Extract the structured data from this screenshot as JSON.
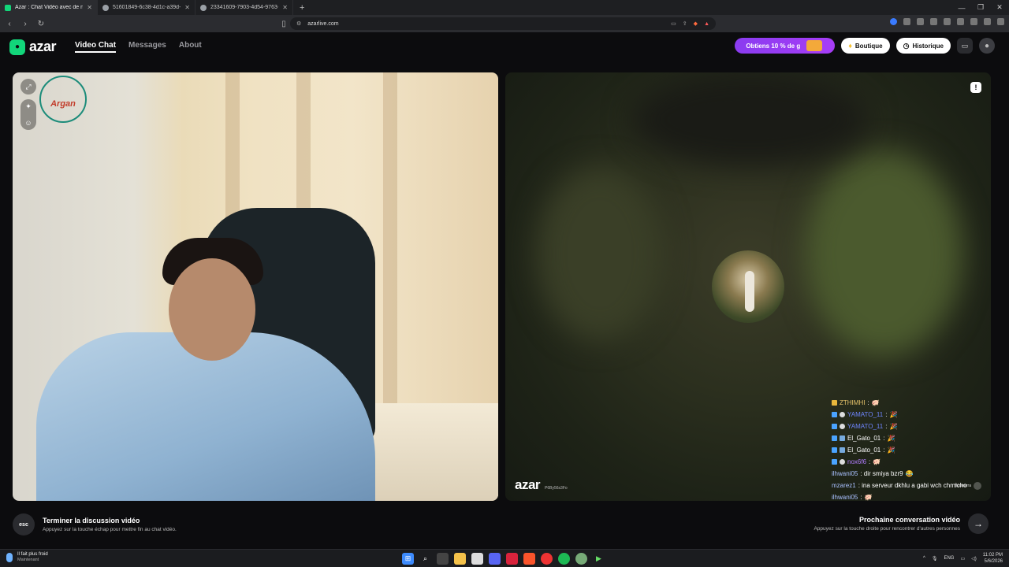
{
  "browser": {
    "tabs": [
      {
        "title": "Azar : Chat Vidéo avec de nou",
        "active": true,
        "favicon_color": "#12d67a"
      },
      {
        "title": "51601849-6c38-4d1c-a39d-6027170",
        "active": false,
        "favicon_color": "#9aa0a6"
      },
      {
        "title": "23341609-7903-4d54-9763-5217d51",
        "active": false,
        "favicon_color": "#9aa0a6"
      }
    ],
    "url": "azarlive.com"
  },
  "header": {
    "logo": "azar",
    "nav": [
      {
        "label": "Video Chat",
        "active": true
      },
      {
        "label": "Messages",
        "active": false
      },
      {
        "label": "About",
        "active": false
      }
    ],
    "promo_label": "Obtiens 10 % de g",
    "shop_label": "Boutique",
    "history_label": "Historique"
  },
  "left_video": {
    "watermark": "Argan"
  },
  "right_video": {
    "watermark": "azar",
    "peer_id": "P6By56s3Fo",
    "chat": [
      {
        "user": "ZTHIMHI",
        "text": ":",
        "emoji": "🐖",
        "style": "gold"
      },
      {
        "user": "YAMATO_11",
        "text": ":",
        "emoji": "🎉",
        "style": "blue"
      },
      {
        "user": "YAMATO_11",
        "text": ":",
        "emoji": "🎉",
        "style": "blue"
      },
      {
        "user": "El_Gato_01",
        "text": ":",
        "emoji": "🎉",
        "style": "plain"
      },
      {
        "user": "El_Gato_01",
        "text": ":",
        "emoji": "🎉",
        "style": "plain"
      },
      {
        "user": "nox6f6",
        "text": ":",
        "emoji": "🐖",
        "style": "purple"
      },
      {
        "user": "ilhwani05",
        "text": ": dir smiya bzr9",
        "emoji": "😂",
        "style": "lt"
      },
      {
        "user": "mzarez1",
        "text": ": ina serveur dkhlu a gabi wch chmicho",
        "emoji": "",
        "style": "lt"
      },
      {
        "user": "ilhwani05",
        "text": ":",
        "emoji": "🐖",
        "style": "lt"
      }
    ],
    "gift_label": "Hourrarra"
  },
  "footer": {
    "esc_key": "esc",
    "end_title": "Terminer la discussion vidéo",
    "end_sub": "Appuyez sur la touche échap pour mettre fin au chat vidéo.",
    "next_title": "Prochaine conversation vidéo",
    "next_sub": "Appuyez sur la touche droite pour rencontrer d'autres personnes"
  },
  "taskbar": {
    "weather_line1": "Il fait plus froid",
    "weather_line2": "Maintenant",
    "lang": "ENG",
    "time": "11:02 PM",
    "date": "5/6/2026"
  },
  "colors": {
    "accent": "#12d67a",
    "promo": "#8a3cf0",
    "username_blue": "#6f86ff"
  }
}
